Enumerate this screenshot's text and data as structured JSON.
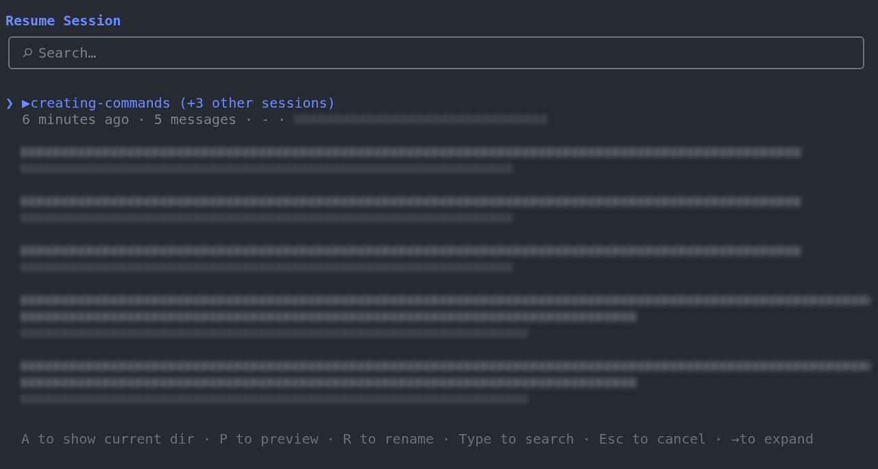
{
  "title": "Resume Session",
  "search": {
    "placeholder": "Search…"
  },
  "pointer": "❯",
  "sessions": [
    {
      "kind": "current",
      "selected": true,
      "marker": "▶",
      "title": "creating-commands (+3 other sessions)",
      "meta": "6 minutes ago · 5 messages · - · "
    },
    {
      "kind": "redacted",
      "selected": false
    },
    {
      "kind": "redacted",
      "selected": false
    },
    {
      "kind": "redacted",
      "selected": false
    },
    {
      "kind": "wrapped",
      "selected": false
    },
    {
      "kind": "wrapped",
      "selected": false
    }
  ],
  "footer": "A to show current dir · P to preview · R to rename · Type to search · Esc to cancel · →to expand"
}
